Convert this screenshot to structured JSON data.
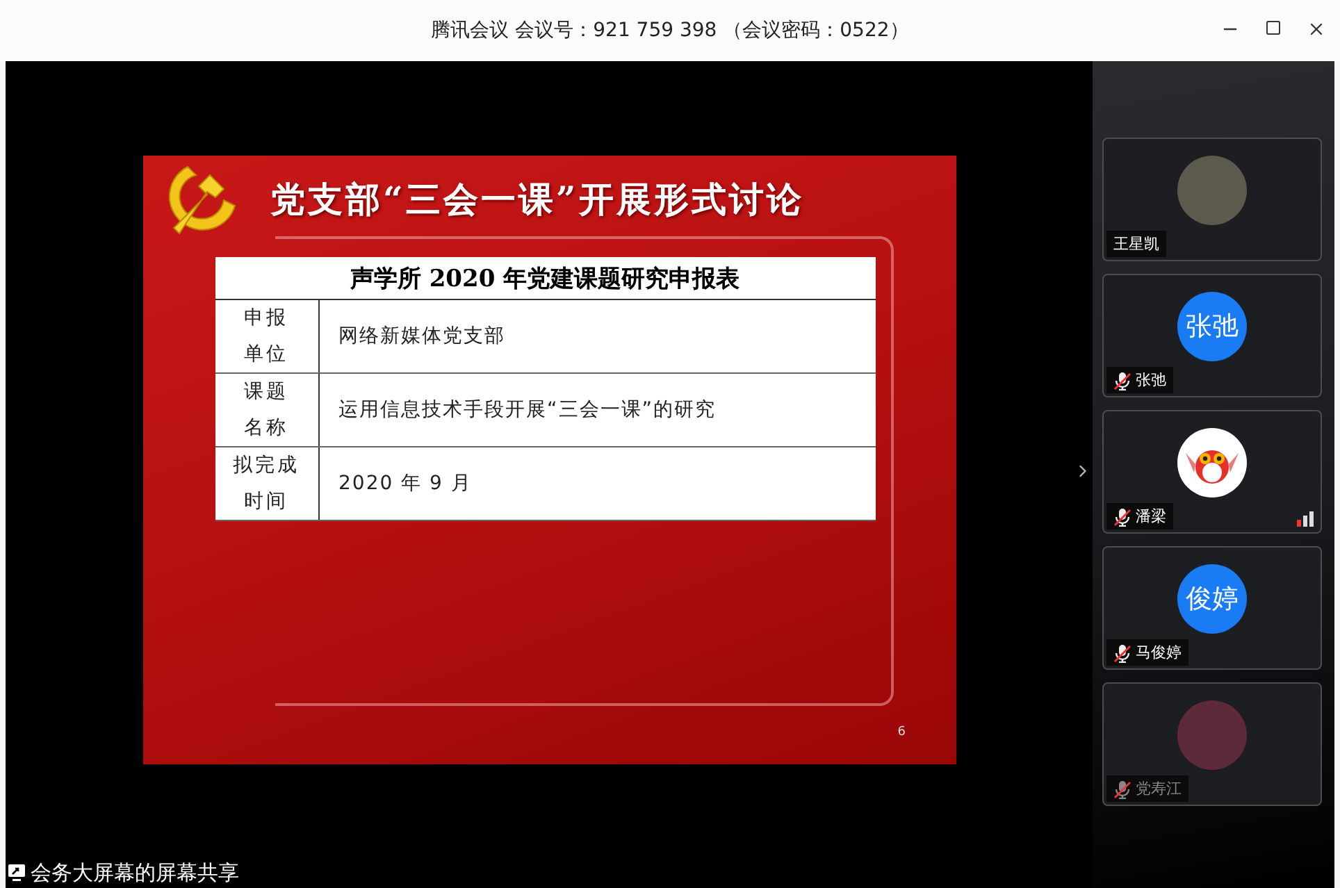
{
  "window": {
    "title": "腾讯会议 会议号：921 759 398 （会议密码：0522）"
  },
  "slide": {
    "heading": "党支部“三会一课”开展形式讨论",
    "table_title": "声学所 2020 年党建课题研究申报表",
    "rows": [
      {
        "label": [
          "申报",
          "单位"
        ],
        "value": "网络新媒体党支部"
      },
      {
        "label": [
          "课题",
          "名称"
        ],
        "value": "运用信息技术手段开展“三会一课”的研究"
      },
      {
        "label": [
          "拟完成",
          "时间"
        ],
        "value": "2020 年 9 月"
      }
    ],
    "page_number": "6"
  },
  "participants": [
    {
      "name": "王星凯",
      "kind": "photo",
      "muted": false,
      "inactive": false,
      "signal": false
    },
    {
      "name": "张弛",
      "kind": "initials",
      "initials": "张弛",
      "muted": true,
      "inactive": false,
      "signal": false
    },
    {
      "name": "潘梁",
      "kind": "cartoon",
      "muted": true,
      "inactive": false,
      "signal": true
    },
    {
      "name": "马俊婷",
      "kind": "initials",
      "initials": "俊婷",
      "muted": true,
      "inactive": false,
      "signal": false
    },
    {
      "name": "党寿江",
      "kind": "photo",
      "muted": true,
      "inactive": true,
      "signal": false
    }
  ],
  "share_label": "会务大屏幕的屏幕共享"
}
